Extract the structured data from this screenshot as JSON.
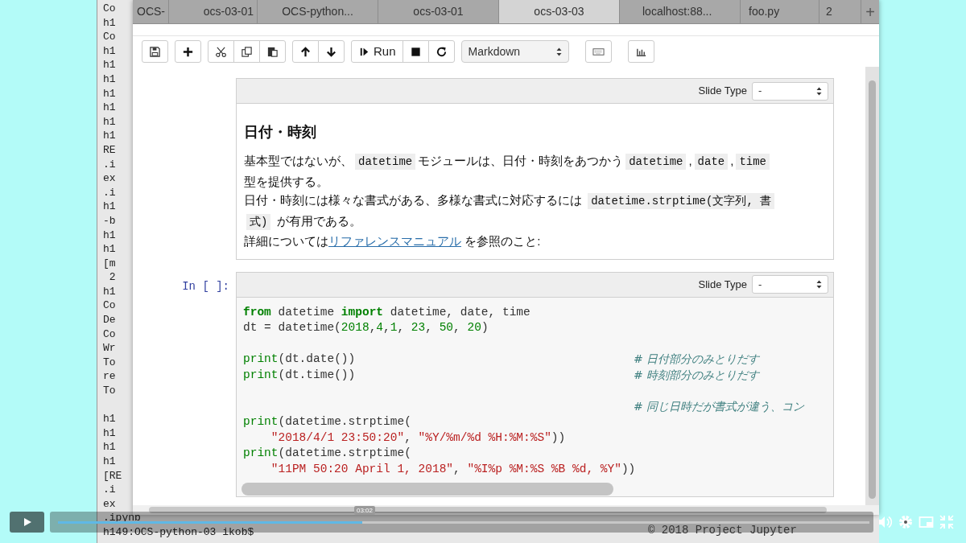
{
  "terminal": {
    "blocks": [
      [
        "Co",
        "h1",
        "Co",
        "h1",
        "h1",
        "h1",
        "h1",
        "h1",
        "h1",
        "h1",
        "RE",
        ".i",
        "ex",
        ".i",
        "h1",
        "-b",
        "h1",
        "h1",
        "[m",
        " 2",
        "h1",
        "Co",
        "De",
        "Co",
        "Wr",
        "To",
        "re",
        "To"
      ],
      [
        "h1",
        "h1",
        "h1",
        "h1",
        "[RE",
        ".i",
        "ex",
        ".ipynb",
        "h149:OCS-python-03 ikob$"
      ]
    ],
    "footer": "© 2018 Project Jupyter"
  },
  "browser": {
    "tabs": [
      {
        "label": "OCS-",
        "selected": false
      },
      {
        "label": "ocs-03-01",
        "selected": false
      },
      {
        "label": "OCS-python...",
        "selected": false
      },
      {
        "label": "ocs-03-01",
        "selected": false
      },
      {
        "label": "ocs-03-03",
        "selected": true
      },
      {
        "label": "localhost:88...",
        "selected": false
      },
      {
        "label": "foo.py",
        "selected": false
      },
      {
        "label": "2",
        "selected": false
      }
    ],
    "new_tab": "+"
  },
  "toolbar": {
    "groups_before": [
      [
        {
          "kind": "save"
        }
      ],
      [
        {
          "kind": "insert"
        }
      ],
      [
        {
          "kind": "cut"
        },
        {
          "kind": "copy"
        },
        {
          "kind": "paste"
        }
      ],
      [
        {
          "kind": "up"
        },
        {
          "kind": "down"
        }
      ],
      [
        {
          "kind": "run",
          "label": "Run"
        },
        {
          "kind": "stop"
        },
        {
          "kind": "restart"
        }
      ]
    ],
    "cell_type": "Markdown",
    "groups_after": [
      [
        {
          "kind": "keyboard"
        }
      ],
      [
        {
          "kind": "chart"
        }
      ]
    ]
  },
  "cells": [
    {
      "kind": "markdown",
      "slide_type_label": "Slide Type",
      "slide_type": "-",
      "heading": "日付・時刻",
      "paragraphs": [
        [
          {
            "kind": "text",
            "text": "基本型ではないが、"
          },
          {
            "kind": "code",
            "text": "datetime"
          },
          {
            "kind": "text",
            "text": "モジュールは、日付・時刻をあつかう"
          },
          {
            "kind": "code",
            "text": "datetime"
          },
          {
            "kind": "text",
            "text": ","
          },
          {
            "kind": "code",
            "text": "date"
          },
          {
            "kind": "text",
            "text": ","
          },
          {
            "kind": "code",
            "text": "time"
          },
          {
            "kind": "text",
            "text": " 型を提供する。"
          }
        ],
        [
          {
            "kind": "text",
            "text": "日付・時刻には様々な書式がある、多様な書式に対応するには "
          },
          {
            "kind": "code",
            "text": "datetime.strptime(文字列, 書式)"
          },
          {
            "kind": "text",
            "text": " が有用である。"
          }
        ],
        [
          {
            "kind": "text",
            "text": "詳細については"
          },
          {
            "kind": "link",
            "text": "リファレンスマニュアル"
          },
          {
            "kind": "text",
            "text": " を参照のこと:"
          }
        ]
      ]
    },
    {
      "kind": "code",
      "prompt": "In [ ]:",
      "slide_type_label": "Slide Type",
      "slide_type": "-",
      "lines": [
        {
          "kind": "code",
          "tokens": [
            {
              "kind": "kw",
              "text": "from"
            },
            {
              "kind": "plain",
              "text": " datetime "
            },
            {
              "kind": "kw",
              "text": "import"
            },
            {
              "kind": "plain",
              "text": " datetime, date, time"
            }
          ]
        },
        {
          "kind": "code",
          "tokens": [
            {
              "kind": "plain",
              "text": "dt = datetime("
            },
            {
              "kind": "num",
              "text": "2018"
            },
            {
              "kind": "plain",
              "text": ","
            },
            {
              "kind": "num",
              "text": "4"
            },
            {
              "kind": "plain",
              "text": ","
            },
            {
              "kind": "num",
              "text": "1"
            },
            {
              "kind": "plain",
              "text": ", "
            },
            {
              "kind": "num",
              "text": "23"
            },
            {
              "kind": "plain",
              "text": ", "
            },
            {
              "kind": "num",
              "text": "50"
            },
            {
              "kind": "plain",
              "text": ", "
            },
            {
              "kind": "num",
              "text": "20"
            },
            {
              "kind": "plain",
              "text": ")"
            }
          ]
        },
        {
          "kind": "blank"
        },
        {
          "kind": "code",
          "tokens": [
            {
              "kind": "builtin",
              "text": "print"
            },
            {
              "kind": "plain",
              "text": "(dt.date())"
            }
          ],
          "comment": "# 日付部分のみとりだす"
        },
        {
          "kind": "code",
          "tokens": [
            {
              "kind": "builtin",
              "text": "print"
            },
            {
              "kind": "plain",
              "text": "(dt.time())"
            }
          ],
          "comment": "# 時刻部分のみとりだす"
        },
        {
          "kind": "blank"
        },
        {
          "kind": "code",
          "comment": "# 同じ日時だが書式が違う、コン"
        },
        {
          "kind": "code",
          "tokens": [
            {
              "kind": "builtin",
              "text": "print"
            },
            {
              "kind": "plain",
              "text": "(datetime.strptime("
            }
          ]
        },
        {
          "kind": "code",
          "indent": true,
          "tokens": [
            {
              "kind": "str",
              "text": "\"2018/4/1 23:50:20\""
            },
            {
              "kind": "plain",
              "text": ", "
            },
            {
              "kind": "str",
              "text": "\"%Y/%m/%d %H:%M:%S\""
            },
            {
              "kind": "plain",
              "text": "))"
            }
          ]
        },
        {
          "kind": "code",
          "tokens": [
            {
              "kind": "builtin",
              "text": "print"
            },
            {
              "kind": "plain",
              "text": "(datetime.strptime("
            }
          ]
        },
        {
          "kind": "code",
          "indent": true,
          "tokens": [
            {
              "kind": "str",
              "text": "\"11PM 50:20 April 1, 2018\""
            },
            {
              "kind": "plain",
              "text": ", "
            },
            {
              "kind": "str",
              "text": "\"%I%p %M:%S %B %d, %Y\""
            },
            {
              "kind": "plain",
              "text": "))"
            }
          ]
        }
      ]
    }
  ],
  "player": {
    "progress": {
      "level": 0.375
    },
    "time_tooltip": "03:02"
  }
}
